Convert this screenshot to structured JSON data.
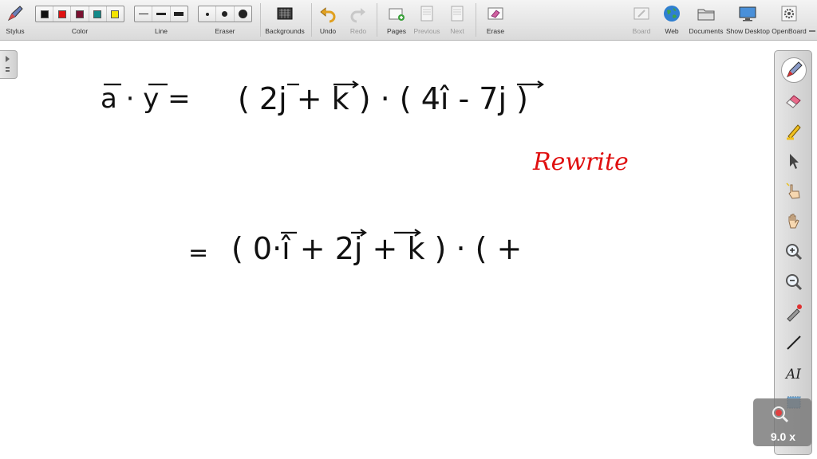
{
  "toolbar": {
    "stylus": "Stylus",
    "color": "Color",
    "line": "Line",
    "eraser": "Eraser",
    "backgrounds": "Backgrounds",
    "undo": "Undo",
    "redo": "Redo",
    "pages": "Pages",
    "previous": "Previous",
    "next": "Next",
    "erase": "Erase",
    "board": "Board",
    "web": "Web",
    "documents": "Documents",
    "show_desktop": "Show Desktop",
    "openboard": "OpenBoard"
  },
  "colors": [
    "#111111",
    "#e01010",
    "#7a1030",
    "#138a8a",
    "#f5e400"
  ],
  "zoom": {
    "level": "9.0 x"
  },
  "board": {
    "lhs": "a · y =",
    "rhs": "( 2j + k ) · ( 4î - 7j )",
    "note": "Rewrite",
    "line2": "( 0·î + 2j + k ) · ( +",
    "equals": "="
  }
}
